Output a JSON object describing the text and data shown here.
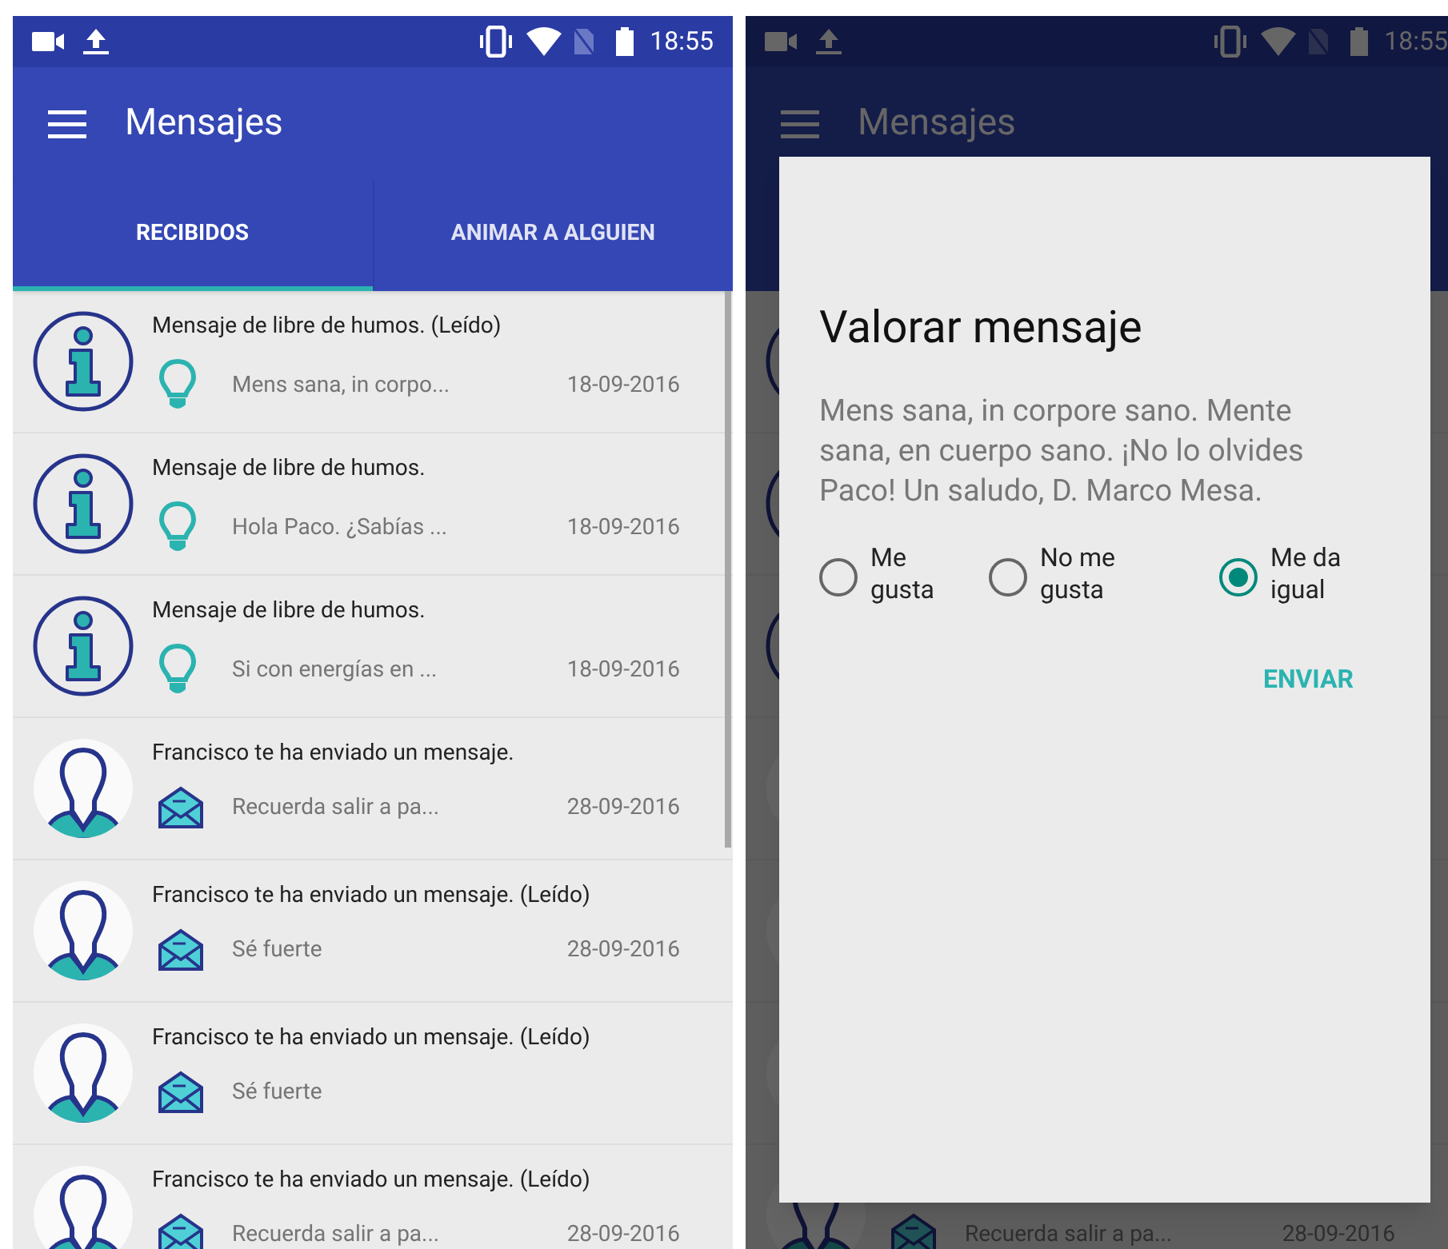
{
  "screens": [
    {
      "status_bar": {
        "time": "18:55"
      },
      "app_bar": {
        "title": "Mensajes"
      },
      "tabs": [
        {
          "label": "RECIBIDOS",
          "selected": true
        },
        {
          "label": "ANIMAR A ALGUIEN",
          "selected": false
        }
      ],
      "messages": [
        {
          "kind": "info",
          "title": "Mensaje de libre de humos. (Leído)",
          "preview": "Mens sana, in corpo...",
          "date": "18-09-2016"
        },
        {
          "kind": "info",
          "title": "Mensaje de libre de humos.",
          "preview": "Hola Paco. ¿Sabías ...",
          "date": "18-09-2016"
        },
        {
          "kind": "info",
          "title": "Mensaje de libre de humos.",
          "preview": "Si con energías en ...",
          "date": "18-09-2016"
        },
        {
          "kind": "person",
          "title": "Francisco te ha enviado un mensaje.",
          "preview": "Recuerda salir a pa...",
          "date": "28-09-2016"
        },
        {
          "kind": "person",
          "title": "Francisco te ha enviado un mensaje. (Leído)",
          "preview": "Sé fuerte",
          "date": "28-09-2016"
        },
        {
          "kind": "person",
          "title": "Francisco te ha enviado un mensaje. (Leído)",
          "preview": "Sé fuerte"
        },
        {
          "kind": "person",
          "title": "Francisco te ha enviado un mensaje. (Leído)",
          "preview": "Recuerda salir a pa...",
          "date": "28-09-2016"
        }
      ]
    },
    {
      "status_bar": {
        "time": "18:55"
      },
      "app_bar": {
        "title": "Mensajes"
      },
      "messages": [
        {
          "kind": "info"
        },
        {
          "kind": "info"
        },
        {
          "kind": "info"
        },
        {
          "kind": "person"
        },
        {
          "kind": "person"
        },
        {
          "kind": "person"
        },
        {
          "kind": "person",
          "preview": "Recuerda salir a pa...",
          "date": "28-09-2016"
        }
      ],
      "dialog": {
        "title": "Valorar mensaje",
        "body": "Mens sana, in corpore sano. Mente sana, en cuerpo sano. ¡No lo olvides Paco! Un saludo, D. Marco Mesa.",
        "options": [
          {
            "label": "Me gusta",
            "selected": false
          },
          {
            "label": "No me gusta",
            "selected": false
          },
          {
            "label": "Me da igual",
            "selected": true
          }
        ],
        "action": "ENVIAR"
      }
    }
  ]
}
